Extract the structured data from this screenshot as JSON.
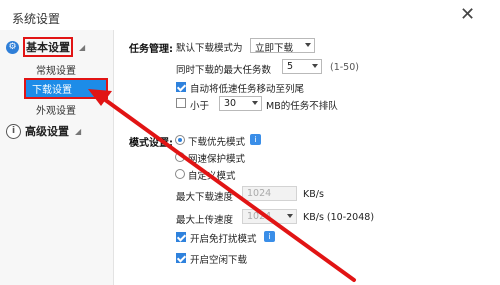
{
  "window": {
    "title": "系统设置",
    "close_icon": "close-icon"
  },
  "sidebar": {
    "basic": {
      "label": "基本设置",
      "icon": "gear-icon"
    },
    "items": [
      {
        "label": "常规设置"
      },
      {
        "label": "下载设置",
        "selected": true
      },
      {
        "label": "外观设置"
      }
    ],
    "advanced": {
      "label": "高级设置",
      "icon": "info-icon"
    }
  },
  "task": {
    "section_label": "任务管理:",
    "default_mode_label": "默认下载模式为",
    "default_mode_value": "立即下载",
    "max_tasks_label": "同时下载的最大任务数",
    "max_tasks_value": "5",
    "max_tasks_range": "(1-50)",
    "auto_move_label": "自动将低速任务移动至列尾",
    "auto_move_checked": true,
    "less_than_label": "小于",
    "less_than_value": "30",
    "less_than_suffix": "MB的任务不排队",
    "less_than_checked": false
  },
  "mode": {
    "section_label": "模式设置:",
    "options": [
      {
        "label": "下载优先模式",
        "checked": true
      },
      {
        "label": "网速保护模式",
        "checked": false
      },
      {
        "label": "自定义模式",
        "checked": false
      }
    ],
    "max_down_label": "最大下载速度",
    "max_down_value": "1024",
    "max_down_unit": "KB/s",
    "max_up_label": "最大上传速度",
    "max_up_value": "1024",
    "max_up_unit": "KB/s  (10-2048)",
    "no_disturb_label": "开启免打扰模式",
    "no_disturb_checked": true,
    "idle_download_label": "开启空闲下载",
    "idle_download_checked": true
  },
  "colors": {
    "accent": "#1d8ce8",
    "highlight": "#e11414"
  }
}
